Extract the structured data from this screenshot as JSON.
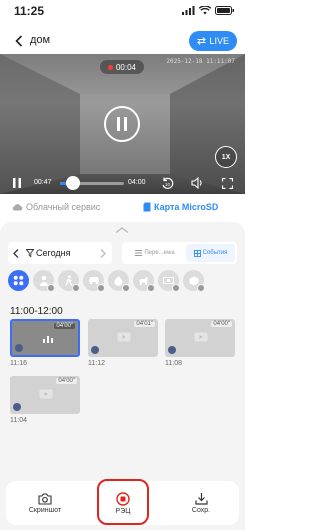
{
  "status_bar": {
    "time": "11:25"
  },
  "nav": {
    "title": "дом",
    "live_label": "LIVE"
  },
  "player": {
    "recording_time": "00:04",
    "timestamp_overlay": "2025-12-18 11:11:07",
    "current_time": "00:47",
    "end_time": "04:00",
    "progress": 0.2,
    "speed_label": "1X"
  },
  "storage_tabs": {
    "cloud": "Облачный сервис",
    "sd": "Карта MicroSD"
  },
  "filter": {
    "date_label": "Сегодня",
    "segment_left": "Пере...ewa",
    "segment_right": "События"
  },
  "categories": [
    {
      "icon": "grid-icon",
      "active": true
    },
    {
      "icon": "person-icon",
      "active": false
    },
    {
      "icon": "walker-icon",
      "active": false
    },
    {
      "icon": "car-icon",
      "active": false
    },
    {
      "icon": "flame-icon",
      "active": false
    },
    {
      "icon": "dog-icon",
      "active": false
    },
    {
      "icon": "cam-icon",
      "active": false
    },
    {
      "icon": "box-icon",
      "active": false
    }
  ],
  "time_range": "11:00-12:00",
  "clips": [
    {
      "duration": "04'00\"",
      "time": "11:16"
    },
    {
      "duration": "04'01\"",
      "time": "11:12"
    },
    {
      "duration": "04'00\"",
      "time": "11:08"
    },
    {
      "duration": "04'00\"",
      "time": "11:04"
    }
  ],
  "bottom_bar": {
    "screenshot": "Скриншот",
    "record": "РЭЦ",
    "save": "Сохр."
  },
  "colors": {
    "accent": "#2f8cf5",
    "selected": "#3b6ff5",
    "record_red": "#e0261c"
  }
}
